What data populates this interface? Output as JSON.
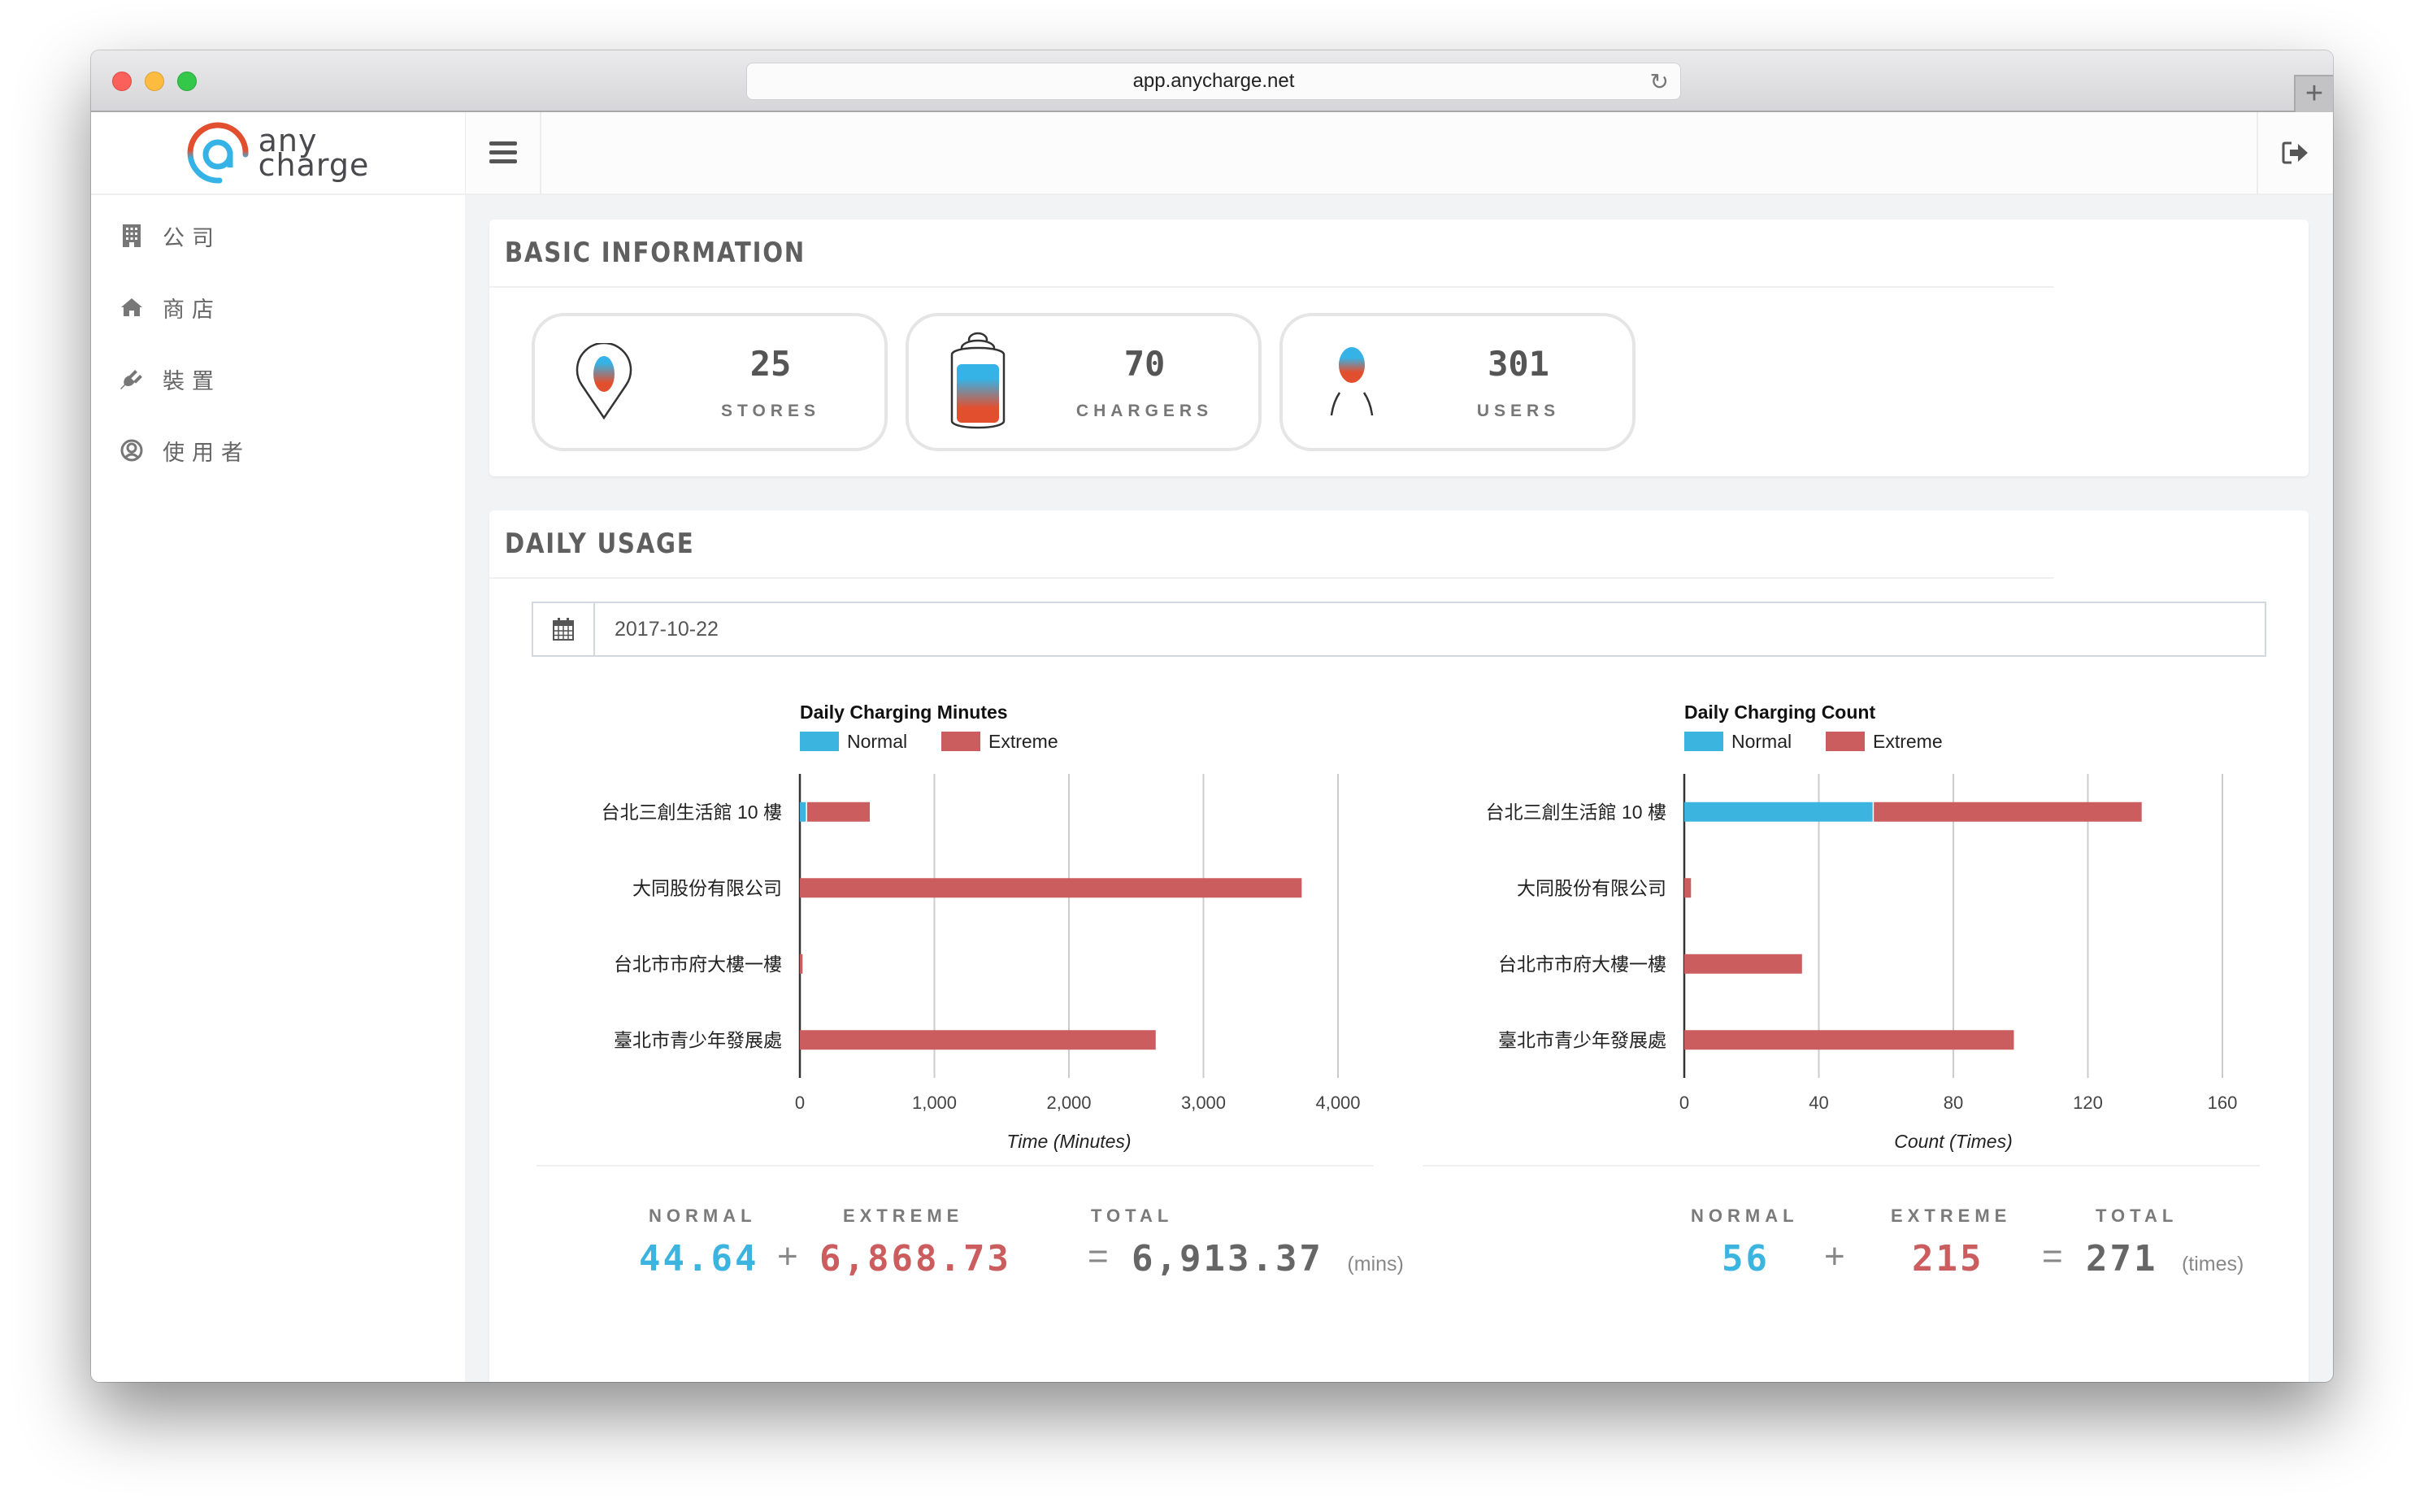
{
  "browser": {
    "url": "app.anycharge.net",
    "reload_icon": "reload-icon",
    "new_tab_label": "+"
  },
  "brand": {
    "line1": "any",
    "line2": "charge"
  },
  "sidebar": {
    "items": [
      {
        "label": "公司",
        "icon": "building-icon"
      },
      {
        "label": "商店",
        "icon": "home-icon"
      },
      {
        "label": "裝置",
        "icon": "plug-icon"
      },
      {
        "label": "使用者",
        "icon": "user-circle-icon"
      }
    ]
  },
  "topbar": {
    "menu_icon": "hamburger-icon",
    "logout_icon": "sign-out-icon"
  },
  "basic_info": {
    "title": "BASIC INFORMATION",
    "stats": [
      {
        "value": "25",
        "label": "STORES",
        "icon": "map-pin-icon"
      },
      {
        "value": "70",
        "label": "CHARGERS",
        "icon": "battery-icon"
      },
      {
        "value": "301",
        "label": "USERS",
        "icon": "user-icon"
      }
    ]
  },
  "colors": {
    "normal": "#3bb4e0",
    "extreme": "#cb5d5f",
    "total": "#666666",
    "accent_red": "#e24f2f",
    "accent_blue": "#35b3e6"
  },
  "daily_usage": {
    "title": "DAILY USAGE",
    "date": "2017-10-22",
    "minutes_summary": {
      "normal_label": "NORMAL",
      "extreme_label": "EXTREME",
      "total_label": "TOTAL",
      "normal": "44.64",
      "plus": "+",
      "extreme": "6,868.73",
      "equals": "=",
      "total": "6,913.37",
      "unit": "(mins)"
    },
    "count_summary": {
      "normal_label": "NORMAL",
      "extreme_label": "EXTREME",
      "total_label": "TOTAL",
      "normal": "56",
      "plus": "+",
      "extreme": "215",
      "equals": "=",
      "total": "271",
      "unit": "(times)"
    }
  },
  "chart_data": [
    {
      "type": "bar",
      "orientation": "horizontal",
      "stacked": true,
      "title": "Daily Charging Minutes",
      "categories": [
        "台北三創生活館 10 樓",
        "大同股份有限公司",
        "台北市市府大樓一樓",
        "臺北市青少年發展處"
      ],
      "series": [
        {
          "name": "Normal",
          "color": "#3bb4e0",
          "values": [
            44.64,
            0,
            0,
            0
          ]
        },
        {
          "name": "Extreme",
          "color": "#cb5d5f",
          "values": [
            475,
            3730,
            20,
            2645
          ]
        }
      ],
      "xlabel": "Time (Minutes)",
      "ylabel": "",
      "xlim": [
        0,
        4000
      ],
      "ticks": [
        0,
        1000,
        2000,
        3000,
        4000
      ],
      "tick_labels": [
        "0",
        "1,000",
        "2,000",
        "3,000",
        "4,000"
      ],
      "grid": true,
      "legend": "top-left"
    },
    {
      "type": "bar",
      "orientation": "horizontal",
      "stacked": true,
      "title": "Daily Charging Count",
      "categories": [
        "台北三創生活館 10 樓",
        "大同股份有限公司",
        "台北市市府大樓一樓",
        "臺北市青少年發展處"
      ],
      "series": [
        {
          "name": "Normal",
          "color": "#3bb4e0",
          "values": [
            56,
            0,
            0,
            0
          ]
        },
        {
          "name": "Extreme",
          "color": "#cb5d5f",
          "values": [
            80,
            2,
            35,
            98
          ]
        }
      ],
      "xlabel": "Count (Times)",
      "ylabel": "",
      "xlim": [
        0,
        160
      ],
      "ticks": [
        0,
        40,
        80,
        120,
        160
      ],
      "tick_labels": [
        "0",
        "40",
        "80",
        "120",
        "160"
      ],
      "grid": true,
      "legend": "top-left"
    }
  ]
}
